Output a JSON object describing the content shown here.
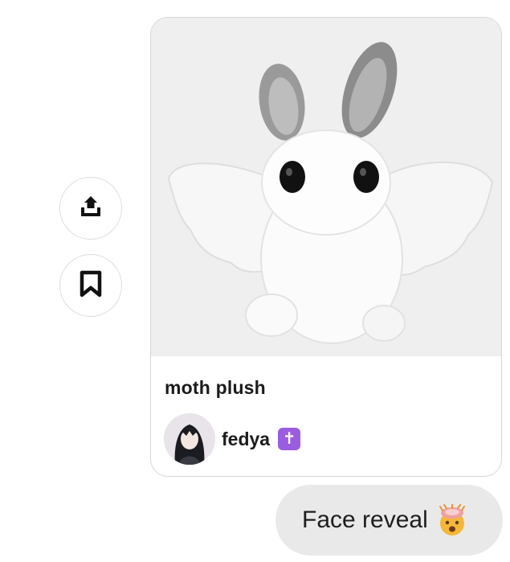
{
  "actions": {
    "share_icon": "share-upload-icon",
    "save_icon": "bookmark-icon"
  },
  "pin": {
    "title": "moth plush",
    "creator": {
      "name": "fedya",
      "badge": "✝"
    }
  },
  "message": {
    "text": "Face reveal",
    "emoji": "exploding-head-emoji"
  },
  "colors": {
    "badge": "#9b5de0",
    "bubble": "#e9e9e9",
    "card_border": "#d6d6d6"
  }
}
